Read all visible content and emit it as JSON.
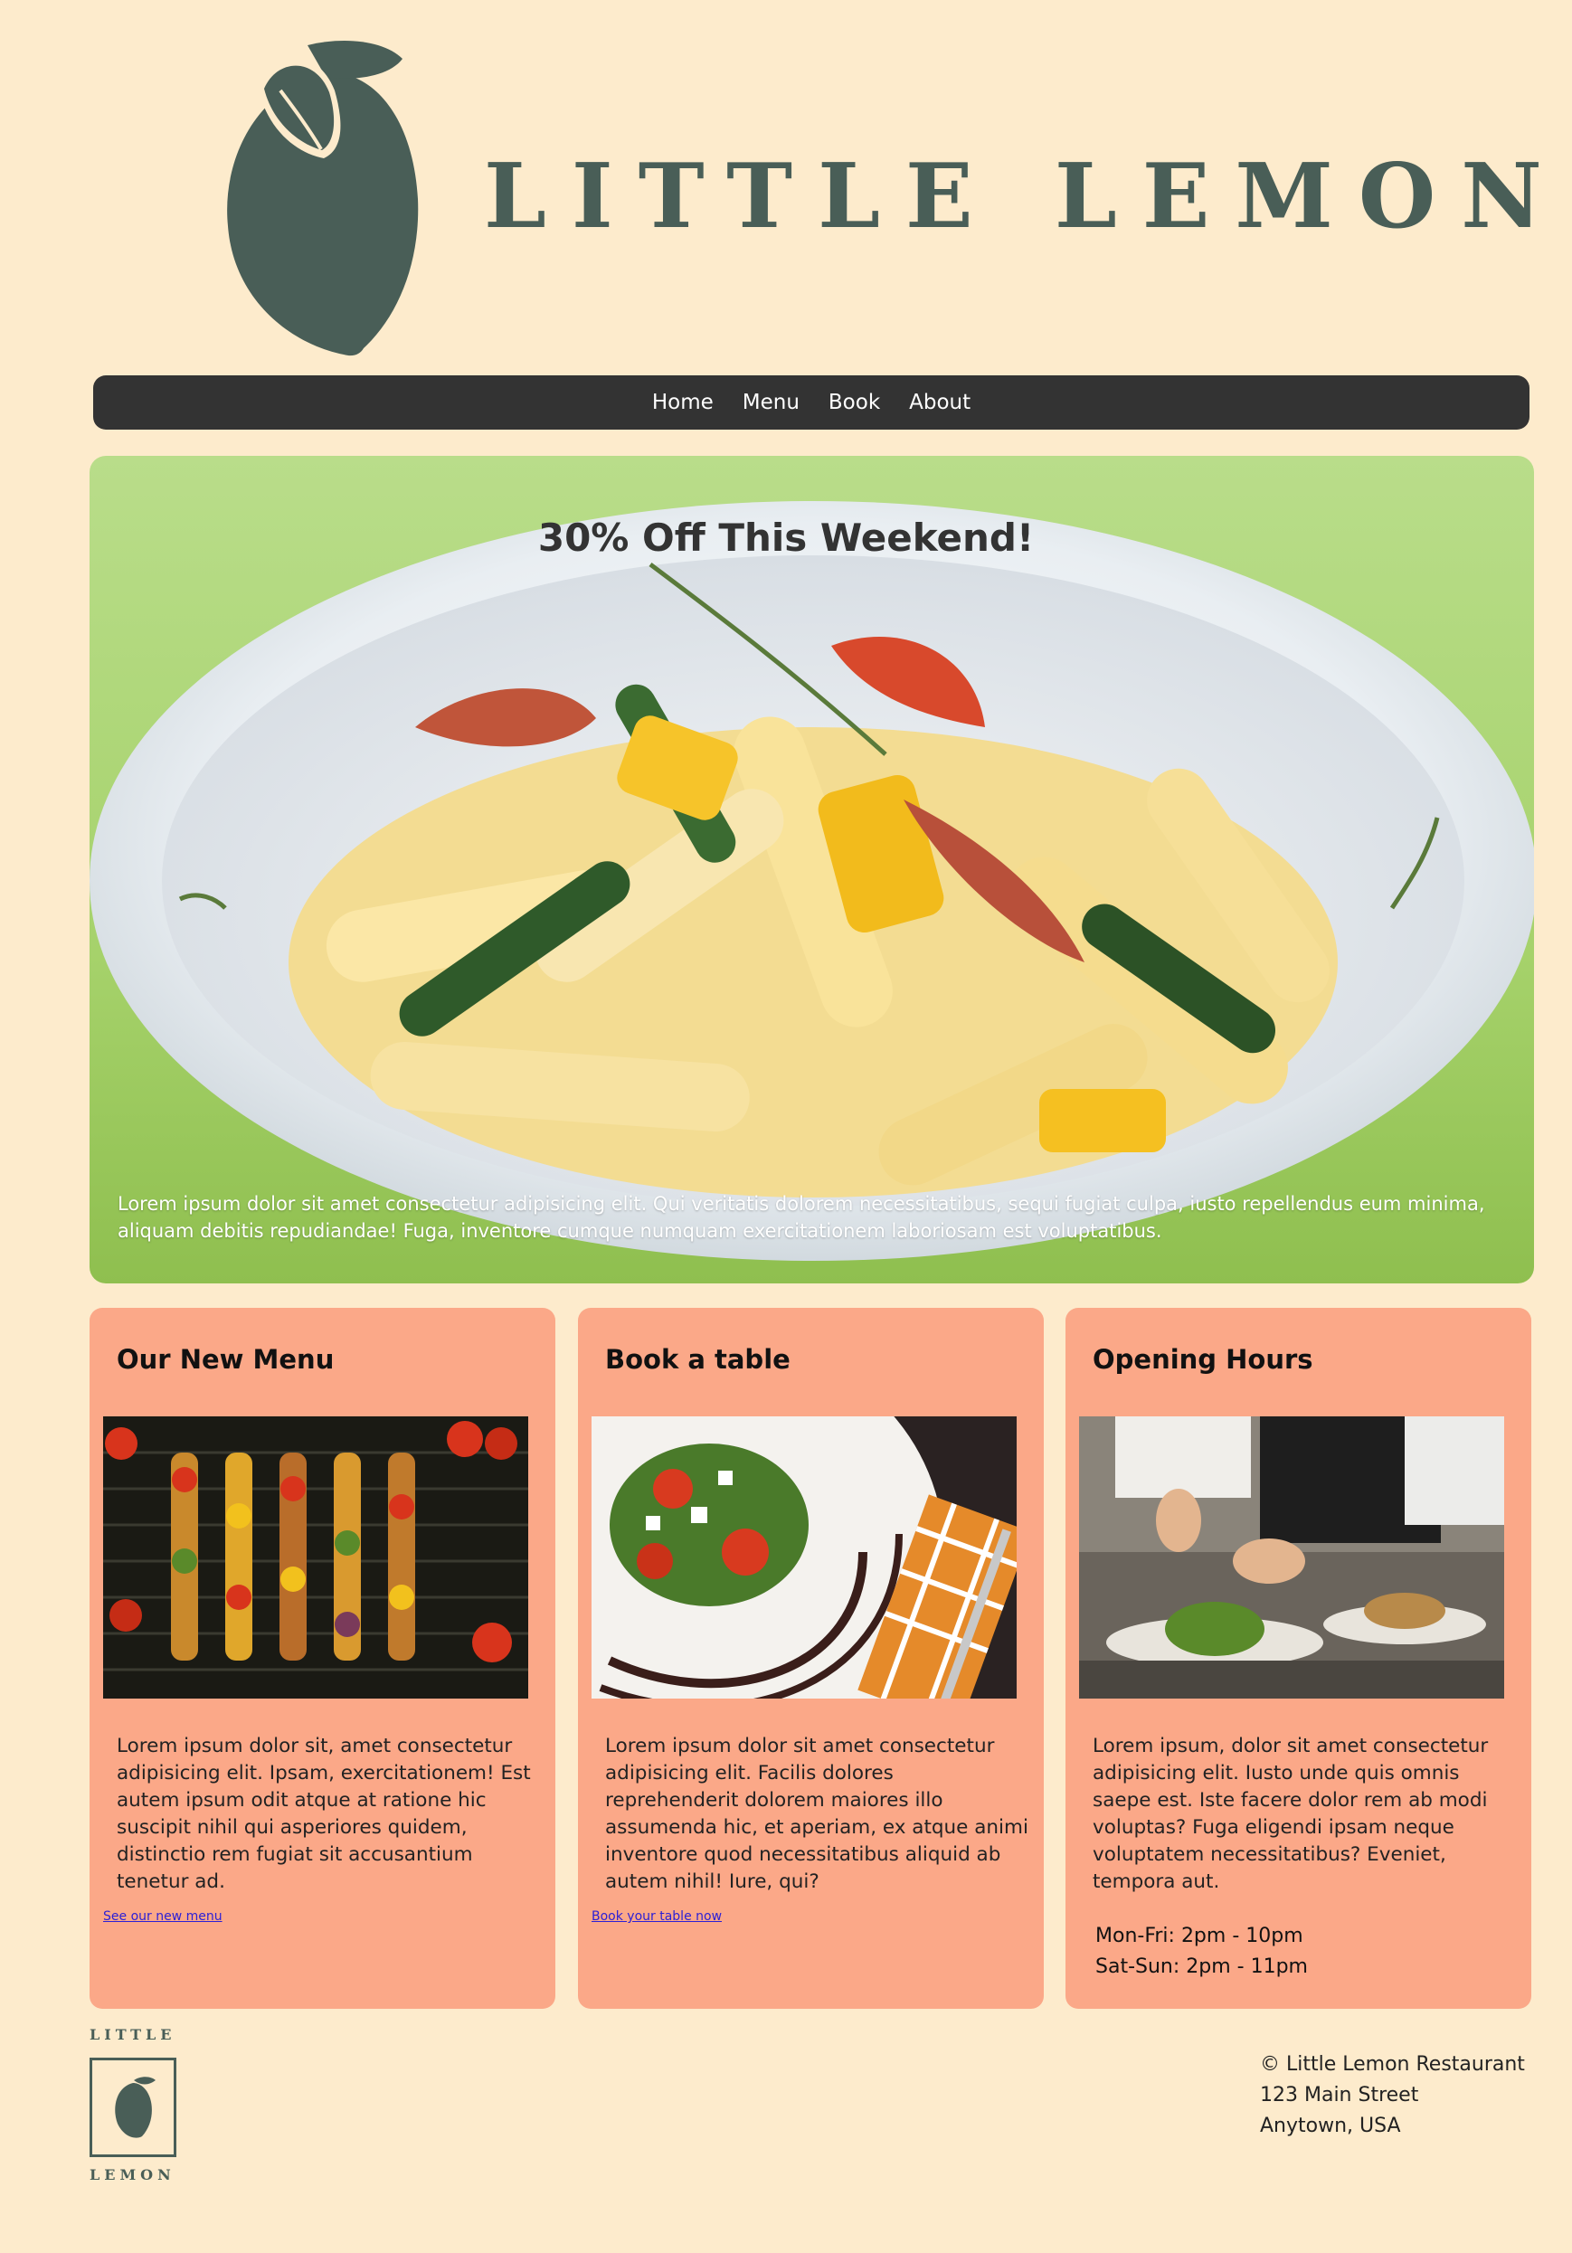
{
  "brand": {
    "name": "LITTLE LEMON",
    "logo_icon": "lemon-icon",
    "color": "#495E57"
  },
  "nav": {
    "items": [
      {
        "label": "Home"
      },
      {
        "label": "Menu"
      },
      {
        "label": "Book"
      },
      {
        "label": "About"
      }
    ]
  },
  "hero": {
    "title": "30% Off This Weekend!",
    "text": "Lorem ipsum dolor sit amet consectetur adipisicing elit. Qui veritatis dolorem necessitatibus, sequi fugiat culpa, iusto repellendus eum minima, aliquam debitis repudiandae! Fuga, inventore cumque numquam exercitationem laboriosam est voluptatibus."
  },
  "cards": [
    {
      "title": "Our New Menu",
      "text": "Lorem ipsum dolor sit, amet consectetur adipisicing elit. Ipsam, exercitationem! Est autem ipsum odit atque at ratione hic suscipit nihil qui asperiores quidem, distinctio rem fugiat sit accusantium tenetur ad.",
      "link": "See our new menu"
    },
    {
      "title": "Book a table",
      "text": "Lorem ipsum dolor sit amet consectetur adipisicing elit. Facilis dolores reprehenderit dolorem maiores illo assumenda hic, et aperiam, ex atque animi inventore quod necessitatibus aliquid ab autem nihil! Iure, qui?",
      "link": "Book your table now"
    },
    {
      "title": "Opening Hours",
      "text": "Lorem ipsum, dolor sit amet consectetur adipisicing elit. Iusto unde quis omnis saepe est. Iste facere dolor rem ab modi voluptas? Fuga eligendi ipsam neque voluptatem necessitatibus? Eveniet, tempora aut.",
      "hours": [
        "Mon-Fri: 2pm - 10pm",
        "Sat-Sun: 2pm - 11pm"
      ]
    }
  ],
  "footer": {
    "logo_top": "LITTLE",
    "logo_bottom": "LEMON",
    "address": [
      "© Little Lemon Restaurant",
      "123 Main Street",
      "Anytown, USA"
    ]
  },
  "colors": {
    "background": "#FDEBCC",
    "nav": "#333333",
    "card": "#FBA888",
    "link": "#2b1fd6"
  }
}
